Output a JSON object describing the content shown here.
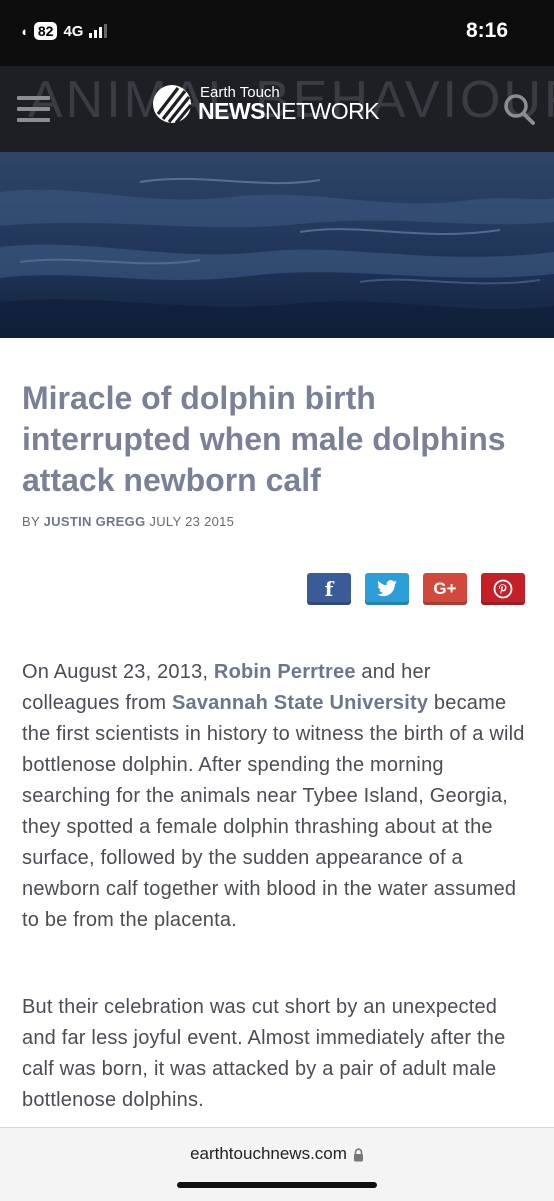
{
  "status_bar": {
    "battery": "82",
    "network": "4G",
    "time": "8:16"
  },
  "header": {
    "background_word": "ANIMAL BEHAVIOUR",
    "logo_line1": "Earth Touch",
    "logo_news": "NEWS",
    "logo_network": "NETWORK"
  },
  "article": {
    "title": "Miracle of dolphin birth interrupted when male dolphins attack newborn calf",
    "byline_prefix": "BY",
    "author": "JUSTIN GREGG",
    "date": "JULY 23 2015",
    "share": [
      "f",
      "",
      "G+",
      ""
    ],
    "p1_before_link1": "On August 23, 2013, ",
    "p1_link1": "Robin Perrtree",
    "p1_between": " and her colleagues from ",
    "p1_link2": "Savannah State University",
    "p1_after": " became the first scientists in history to witness the birth of a wild bottlenose dolphin. After spending the morning searching for the animals near Tybee Island, Georgia, they spotted a female dolphin thrashing about at the surface, followed by the sudden appearance of a newborn calf together with blood in the water assumed to be from the placenta.",
    "p2": "But their celebration was cut short by an unexpected and far less joyful event. Almost immediately after the calf was born, it was attacked by a pair of adult male bottlenose dolphins."
  },
  "colors": {
    "facebook": "#3b5b98",
    "twitter": "#2c9fd8",
    "google_plus": "#d2483c",
    "pinterest": "#c32127",
    "title": "#7a8196"
  },
  "browser": {
    "url": "earthtouchnews.com"
  }
}
